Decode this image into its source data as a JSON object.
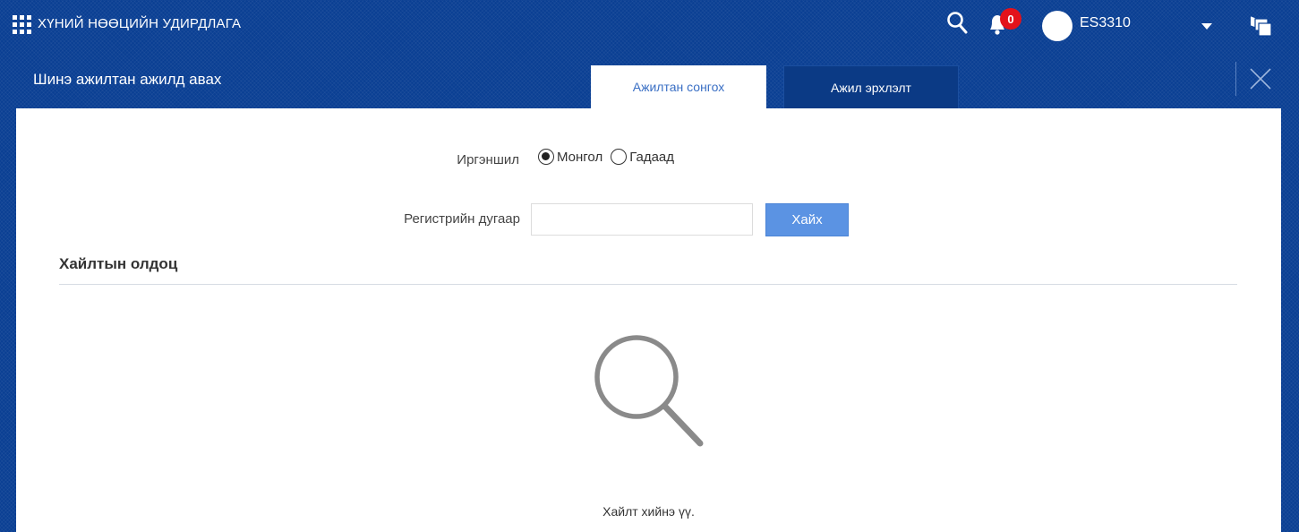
{
  "app": {
    "title": "ХҮНИЙ НӨӨЦИЙН УДИРДЛАГА",
    "notifications_count": "0",
    "username": "ES3310"
  },
  "dialog": {
    "title": "Шинэ ажилтан ажилд авах",
    "tabs": [
      {
        "label": "Ажилтан сонгох",
        "active": true
      },
      {
        "label": "Ажил эрхлэлт",
        "active": false
      }
    ]
  },
  "form": {
    "citizenship_label": "Иргэншил",
    "citizenship_options": [
      {
        "label": "Монгол",
        "checked": true
      },
      {
        "label": "Гадаад",
        "checked": false
      }
    ],
    "register_label": "Регистрийн дугаар",
    "register_value": "",
    "search_button": "Хайх"
  },
  "results": {
    "title": "Хайлтын олдоц",
    "empty_message": "Хайлт хийнэ үү."
  },
  "icons": [
    "apps-grid-icon",
    "search-icon",
    "bell-icon",
    "avatar",
    "chevron-down-icon",
    "cards-icon",
    "close-icon",
    "magnifier-icon"
  ],
  "colors": {
    "background": "#0a3f93",
    "badge": "#e3121b",
    "accent_button": "#5b93e3",
    "active_tab_text": "#3a6fc4"
  }
}
